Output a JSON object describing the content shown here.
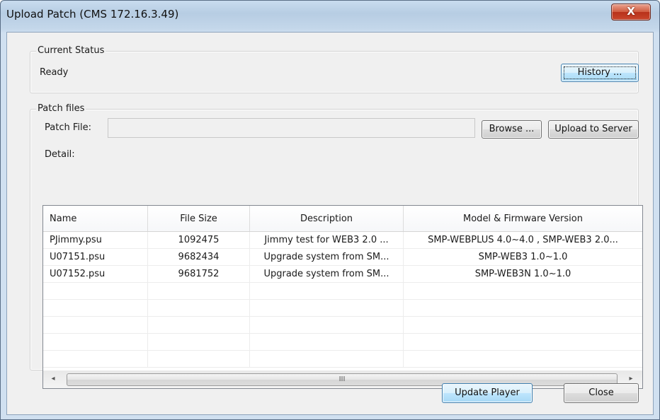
{
  "window": {
    "title": "Upload Patch (CMS  172.16.3.49)",
    "close_glyph": "X"
  },
  "status_group": {
    "title": "Current Status",
    "status_text": "Ready",
    "history_button": "History ..."
  },
  "patch_group": {
    "title": "Patch files",
    "patch_file_label": "Patch File:",
    "patch_file_value": "",
    "browse_button": "Browse ...",
    "upload_button": "Upload to Server",
    "detail_label": "Detail:"
  },
  "table": {
    "columns": [
      "Name",
      "File Size",
      "Description",
      "Model & Firmware Version"
    ],
    "rows": [
      {
        "name": "PJimmy.psu",
        "size": "1092475",
        "description": "Jimmy test for WEB3 2.0 ...",
        "model": "SMP-WEBPLUS  4.0~4.0 , SMP-WEB3  2.0..."
      },
      {
        "name": "U07151.psu",
        "size": "9682434",
        "description": "Upgrade system from SM...",
        "model": "SMP-WEB3  1.0~1.0"
      },
      {
        "name": "U07152.psu",
        "size": "9681752",
        "description": "Upgrade system from SM...",
        "model": "SMP-WEB3N  1.0~1.0"
      },
      {
        "name": "",
        "size": "",
        "description": "",
        "model": ""
      },
      {
        "name": "",
        "size": "",
        "description": "",
        "model": ""
      },
      {
        "name": "",
        "size": "",
        "description": "",
        "model": ""
      },
      {
        "name": "",
        "size": "",
        "description": "",
        "model": ""
      },
      {
        "name": "",
        "size": "",
        "description": "",
        "model": ""
      }
    ],
    "scroll_left_icon": "◂",
    "scroll_right_icon": "▸",
    "scroll_grip": "III"
  },
  "footer": {
    "update_button": "Update Player",
    "close_button": "Close"
  },
  "icons": {
    "close": "close-icon",
    "scroll_left": "scroll-left-arrow-icon",
    "scroll_right": "scroll-right-arrow-icon"
  }
}
